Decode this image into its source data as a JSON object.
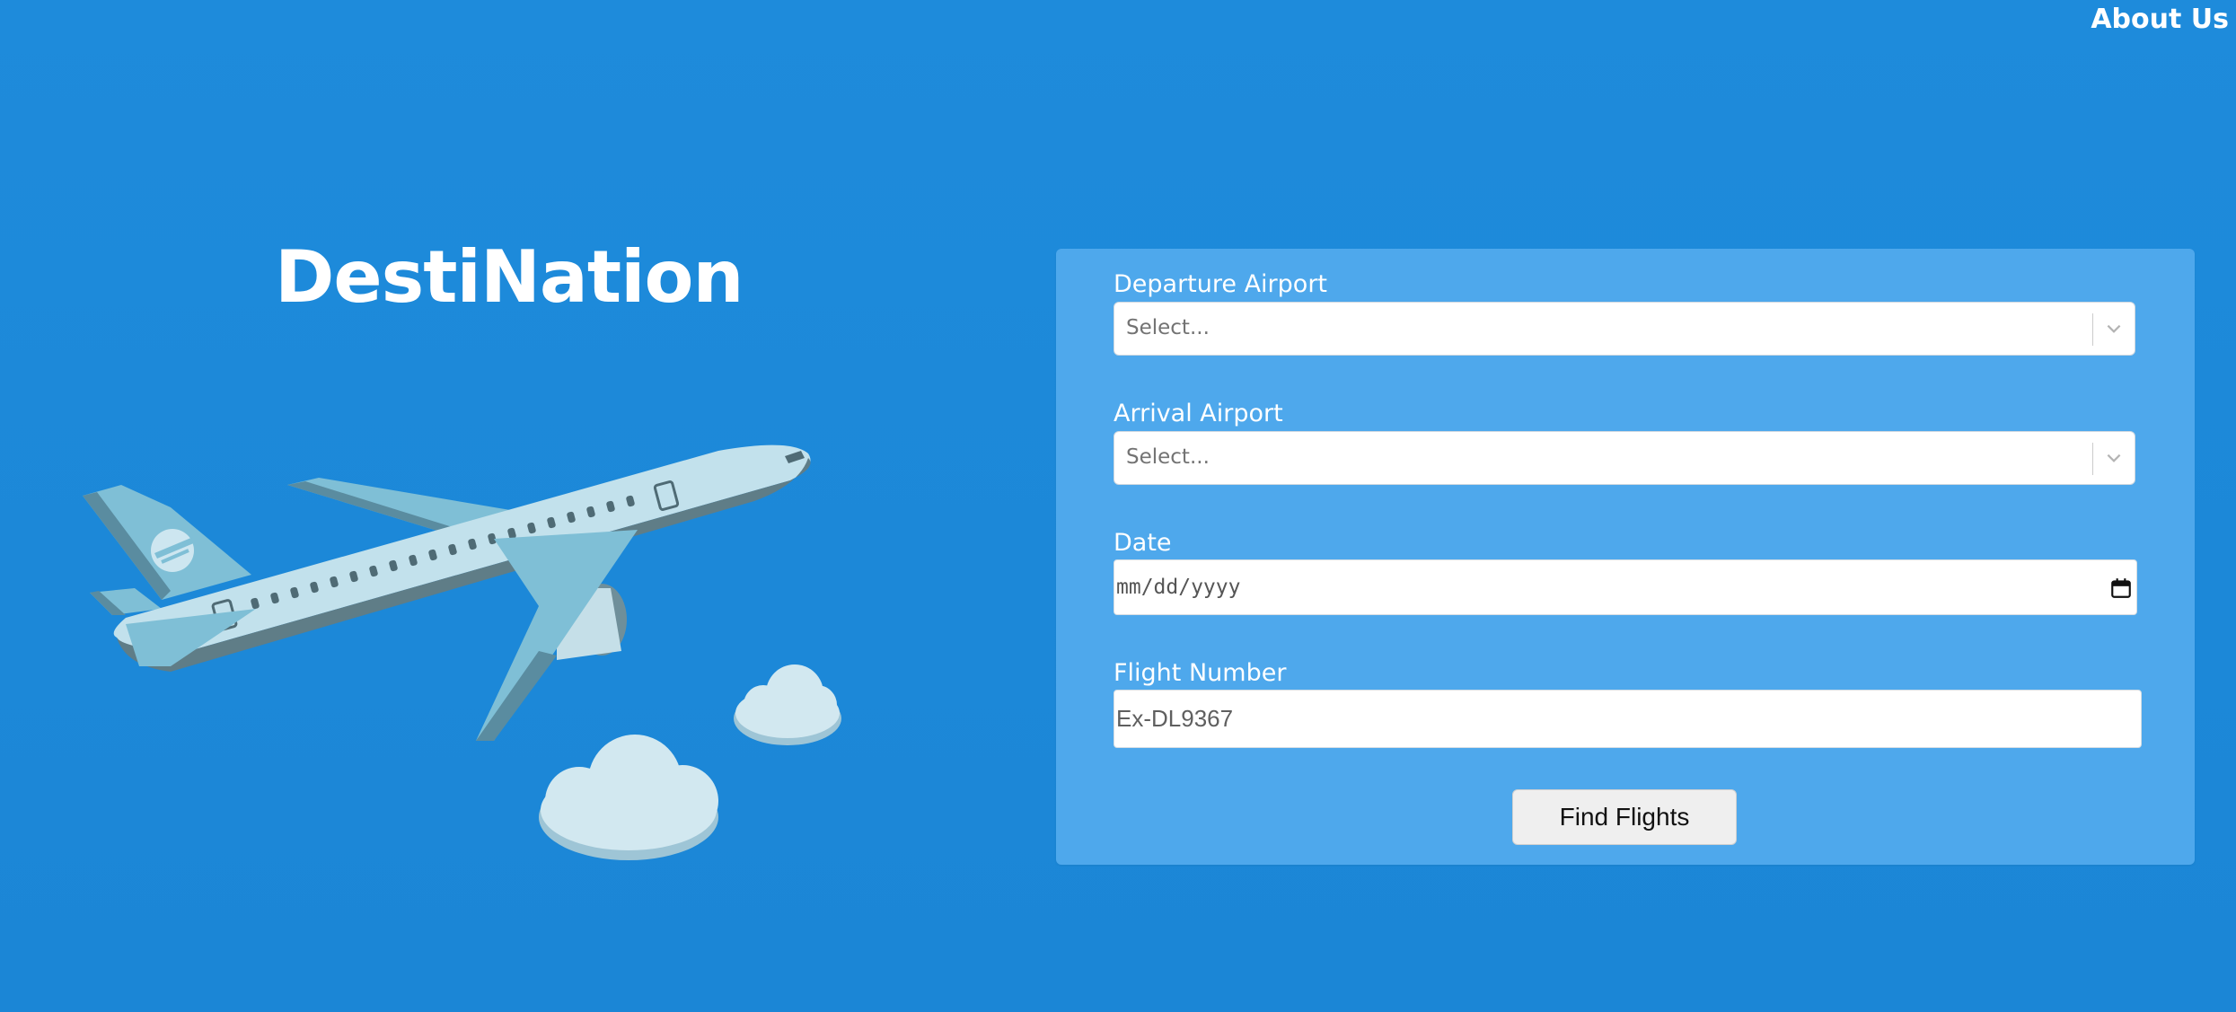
{
  "nav": {
    "about_label": "About Us"
  },
  "brand": {
    "name": "DestiNation"
  },
  "form": {
    "departure": {
      "label": "Departure Airport",
      "placeholder": "Select..."
    },
    "arrival": {
      "label": "Arrival Airport",
      "placeholder": "Select..."
    },
    "date": {
      "label": "Date",
      "value": "mm/dd/yyyy"
    },
    "flight_number": {
      "label": "Flight Number",
      "placeholder": "Ex-DL9367"
    },
    "submit_label": "Find Flights"
  },
  "icons": {
    "select_chevron": "chevron-down-icon",
    "date_picker": "calendar-icon"
  },
  "colors": {
    "background": "#1d89d9",
    "panel": "#4ea8ec",
    "text": "#ffffff",
    "button": "#efefef"
  }
}
